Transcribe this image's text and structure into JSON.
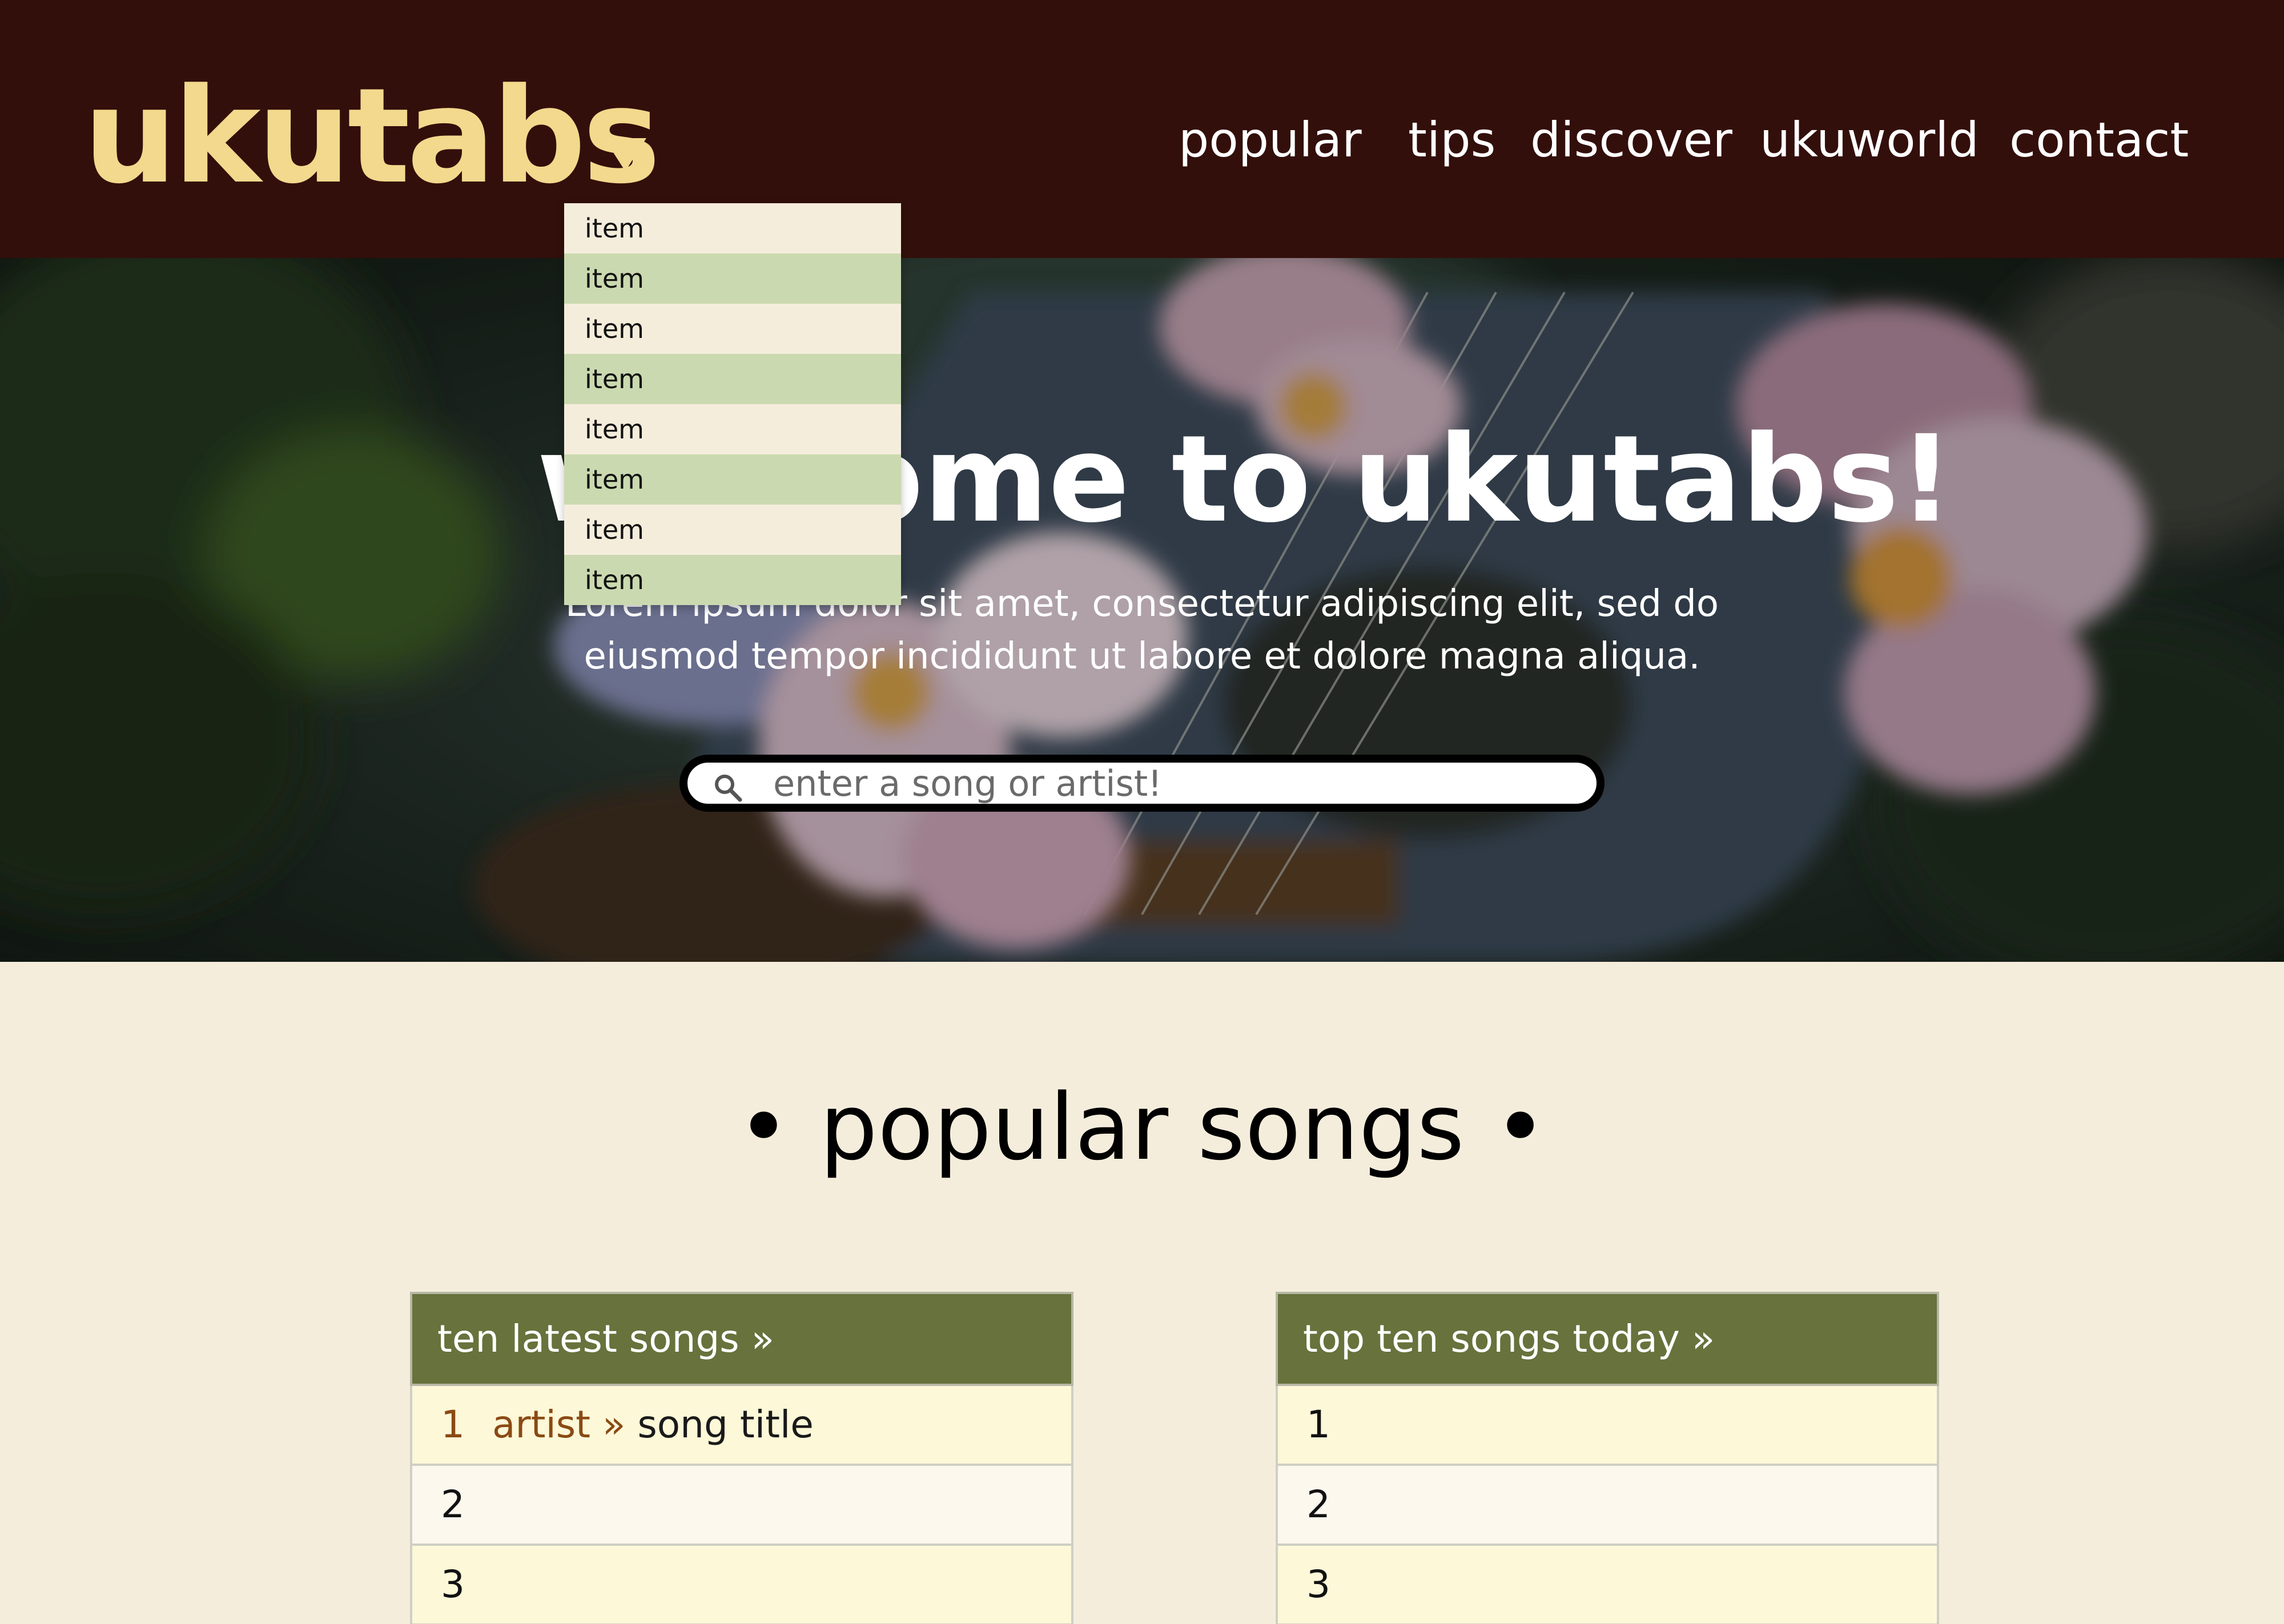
{
  "brand": {
    "logo": "ukutabs",
    "logo_color": "#f2d98d",
    "header_bg": "#330f0b"
  },
  "nav": {
    "items": [
      "popular",
      "tips",
      "discover",
      "ukuworld",
      "contact"
    ]
  },
  "dropdown": {
    "items": [
      "item",
      "item",
      "item",
      "item",
      "item",
      "item",
      "item",
      "item"
    ]
  },
  "hero": {
    "title": "welcome to ukutabs!",
    "text": "Lorem ipsum dolor sit amet, consectetur adipiscing elit, sed do eiusmod tempor incididunt ut labore et dolore magna aliqua.",
    "search_placeholder": "enter a song or artist!"
  },
  "popular": {
    "title": "• popular songs •",
    "latest": {
      "header": "ten latest songs »",
      "rows": [
        {
          "rank": "1",
          "artist": "artist »",
          "song": "song title"
        },
        {
          "rank": "2"
        },
        {
          "rank": "3"
        }
      ]
    },
    "top": {
      "header": "top ten songs today »",
      "rows": [
        {
          "rank": "1"
        },
        {
          "rank": "2"
        },
        {
          "rank": "3"
        }
      ]
    }
  },
  "colors": {
    "page_bg": "#f5eddc",
    "panel_header": "#67723c",
    "dropdown_alt": "#cbd9b0",
    "artist_accent": "#8a4a14"
  }
}
